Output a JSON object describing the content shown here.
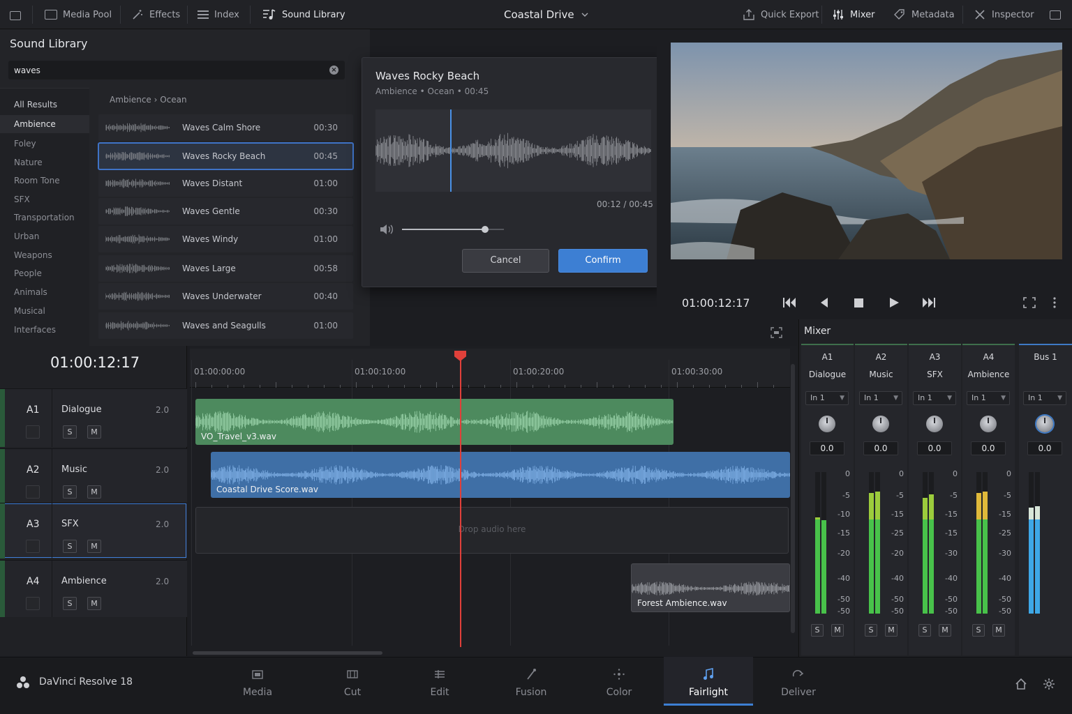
{
  "topbar": {
    "media_pool": "Media Pool",
    "effects": "Effects",
    "index": "Index",
    "sound_library": "Sound Library",
    "project_title": "Coastal Drive",
    "quick_export": "Quick Export",
    "mixer": "Mixer",
    "metadata": "Metadata",
    "inspector": "Inspector"
  },
  "library": {
    "title": "Sound Library",
    "search_value": "waves",
    "categories": [
      "All Results",
      "Ambience",
      "Foley",
      "Nature",
      "Room Tone",
      "SFX",
      "Transportation",
      "Urban",
      "Weapons",
      "People",
      "Animals",
      "Musical",
      "Interfaces"
    ],
    "selected_category": "Ambience",
    "breadcrumb": "Ambience  ›  Ocean",
    "results": [
      {
        "name": "Waves Calm Shore",
        "duration": "00:30"
      },
      {
        "name": "Waves Rocky Beach",
        "duration": "00:45",
        "selected": true
      },
      {
        "name": "Waves Distant",
        "duration": "01:00"
      },
      {
        "name": "Waves Gentle",
        "duration": "00:30"
      },
      {
        "name": "Waves Windy",
        "duration": "01:00"
      },
      {
        "name": "Waves Large",
        "duration": "00:58"
      },
      {
        "name": "Waves Underwater",
        "duration": "00:40"
      },
      {
        "name": "Waves and Seagulls",
        "duration": "01:00"
      }
    ]
  },
  "preview": {
    "title": "Waves Rocky Beach",
    "meta": "Ambience  •  Ocean  •  00:45",
    "time": "00:12 / 00:45",
    "progress": 0.27,
    "volume": 0.82,
    "cancel": "Cancel",
    "confirm": "Confirm"
  },
  "viewer": {
    "timecode": "01:00:12:17"
  },
  "timeline": {
    "timecode": "01:00:12:17",
    "ruler": [
      "01:00:00:00",
      "01:00:10:00",
      "01:00:20:00",
      "01:00:30:00"
    ],
    "tracks": [
      {
        "id": "A1",
        "name": "Dialogue",
        "channels": "2.0"
      },
      {
        "id": "A2",
        "name": "Music",
        "channels": "2.0"
      },
      {
        "id": "A3",
        "name": "SFX",
        "channels": "2.0",
        "selected": true
      },
      {
        "id": "A4",
        "name": "Ambience",
        "channels": "2.0"
      }
    ],
    "clips": {
      "a1": "VO_Travel_v3.wav",
      "a2": "Coastal Drive Score.wav",
      "a4": "Forest Ambience.wav"
    },
    "drop_text": "Drop audio here",
    "solo": "S",
    "mute": "M"
  },
  "mixer": {
    "title": "Mixer",
    "strips": [
      {
        "id": "A1",
        "name": "Dialogue",
        "input": "In 1",
        "value": "0.0",
        "scale": [
          "0",
          "-5",
          "-10",
          "-15",
          "-20",
          "-40",
          "-50",
          "-50"
        ]
      },
      {
        "id": "A2",
        "name": "Music",
        "input": "In 1",
        "value": "0.0",
        "scale": [
          "0",
          "-5",
          "-15",
          "-25",
          "-20",
          "-40",
          "-50",
          "-50"
        ]
      },
      {
        "id": "A3",
        "name": "SFX",
        "input": "In 1",
        "value": "0.0",
        "scale": [
          "0",
          "-5",
          "-15",
          "-15",
          "-30",
          "-40",
          "-50",
          "-50"
        ]
      },
      {
        "id": "A4",
        "name": "Ambience",
        "input": "In 1",
        "value": "0.0",
        "scale": [
          "0",
          "-5",
          "-15",
          "-25",
          "-30",
          "-40",
          "-50",
          "-50"
        ]
      },
      {
        "id": "Bus 1",
        "name": "",
        "input": "In 1",
        "value": "0.0"
      }
    ]
  },
  "bottombar": {
    "brand": "DaVinci Resolve 18",
    "pages": [
      "Media",
      "Cut",
      "Edit",
      "Fusion",
      "Color",
      "Fairlight",
      "Deliver"
    ],
    "selected_page": "Fairlight"
  }
}
